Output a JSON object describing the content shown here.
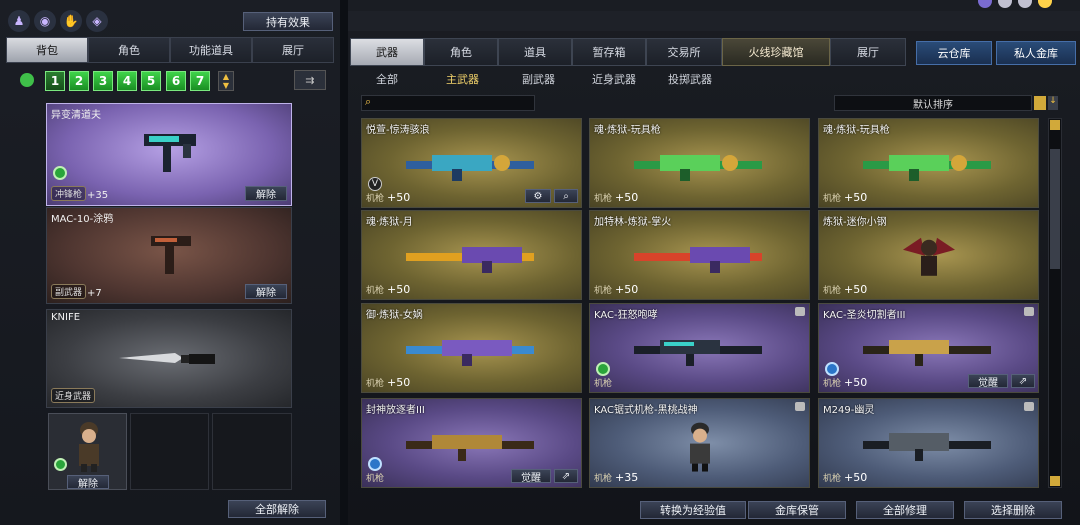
{
  "left": {
    "effects_button": "持有效果",
    "tabs": [
      "背包",
      "角色",
      "功能道具",
      "展厅"
    ],
    "pages": [
      "1",
      "2",
      "3",
      "4",
      "5",
      "6",
      "7"
    ],
    "items": [
      {
        "title": "异变清道夫",
        "category": "冲锋枪",
        "value": "+35",
        "action": "解除"
      },
      {
        "title": "MAC-10-涂鸦",
        "category": "副武器",
        "value": "+7",
        "action": "解除"
      },
      {
        "title": "KNIFE",
        "category": "近身武器"
      }
    ],
    "character_action": "解除",
    "unequip_all": "全部解除"
  },
  "right": {
    "tabs": [
      "武器",
      "角色",
      "道具",
      "暂存箱",
      "交易所",
      "火线珍藏馆",
      "展厅"
    ],
    "cloud_tab": "云仓库",
    "vault_tab": "私人金库",
    "subtabs": [
      "全部",
      "主武器",
      "副武器",
      "近身武器",
      "投掷武器"
    ],
    "sort_label": "默认排序",
    "cards": [
      {
        "title": "悦萱-惊涛骇浪",
        "cat": "机枪",
        "value": "+50"
      },
      {
        "title": "魂·炼狱-玩具枪",
        "cat": "机枪",
        "value": "+50"
      },
      {
        "title": "魂·炼狱-玩具枪",
        "cat": "机枪",
        "value": "+50"
      },
      {
        "title": "魂·炼狱-月",
        "cat": "机枪",
        "value": "+50"
      },
      {
        "title": "加特林-炼狱-掌火",
        "cat": "机枪",
        "value": "+50"
      },
      {
        "title": "炼狱-迷你小钢",
        "cat": "机枪",
        "value": "+50"
      },
      {
        "title": "御·炼狱-女娲",
        "cat": "机枪",
        "value": "+50"
      },
      {
        "title": "KAC-狂怒咆哮",
        "cat": "机枪",
        "value": ""
      },
      {
        "title": "KAC-圣炎切割者III",
        "cat": "机枪",
        "value": "+50",
        "awaken": "觉醒"
      },
      {
        "title": "封神放逐者III",
        "cat": "机枪",
        "value": "",
        "awaken": "觉醒"
      },
      {
        "title": "KAC锯式机枪-黑桃战神",
        "cat": "机枪",
        "value": "+35"
      },
      {
        "title": "M249-幽灵",
        "cat": "机枪",
        "value": "+50"
      }
    ],
    "bottom_buttons": [
      "转换为经验值",
      "金库保管",
      "全部修理",
      "选择删除"
    ],
    "v_mark": "V"
  },
  "colors": {
    "accent_gold": "#f2d36b",
    "tab_blue": "#2a4c78",
    "green_page": "#3fd34a"
  }
}
